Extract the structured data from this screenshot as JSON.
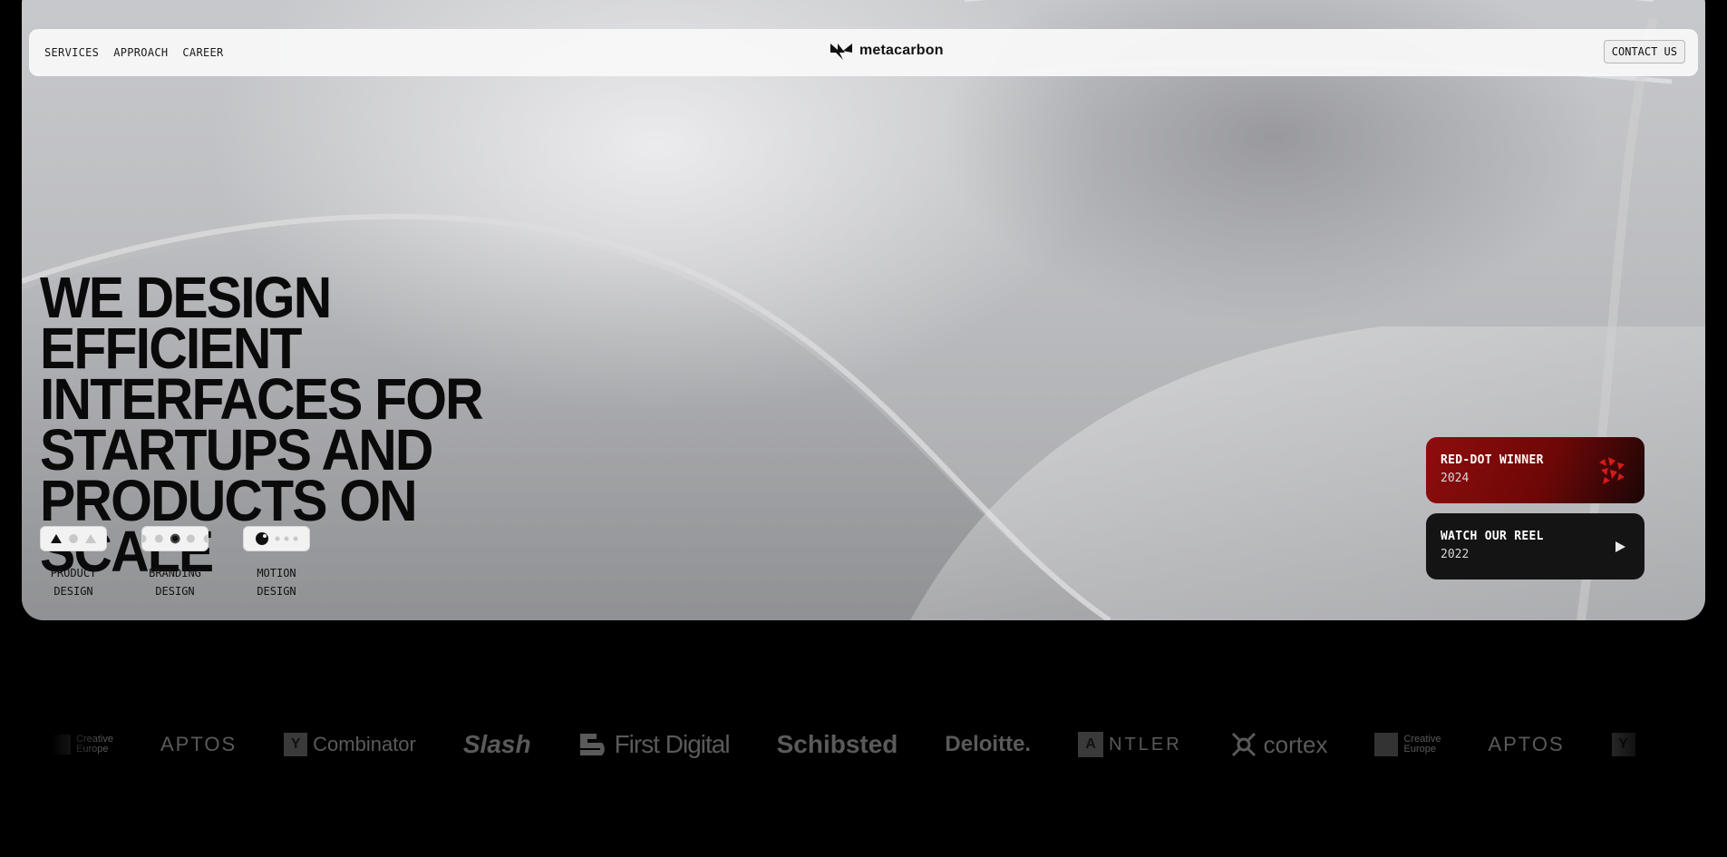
{
  "nav": {
    "links": [
      "SERVICES",
      "APPROACH",
      "CAREER"
    ],
    "brand": "metacarbon",
    "contact_label": "CONTACT US"
  },
  "hero": {
    "headline_lines": [
      "WE DESIGN EFFICIENT",
      "INTERFACES FOR",
      "STARTUPS AND",
      "PRODUCTS ON SCALE"
    ],
    "services": [
      {
        "line1": "PRODUCT",
        "line2": "DESIGN"
      },
      {
        "line1": "BRANDING",
        "line2": "DESIGN"
      },
      {
        "line1": "MOTION",
        "line2": "DESIGN"
      }
    ]
  },
  "cards": {
    "award": {
      "title": "RED-DOT WINNER",
      "year": "2024"
    },
    "reel": {
      "title": "WATCH OUR REEL",
      "year": "2022"
    }
  },
  "logos": [
    {
      "type": "stack",
      "line1": "Creative",
      "line2": "Europe"
    },
    {
      "type": "text",
      "name": "APTOS"
    },
    {
      "type": "box",
      "box": "Y",
      "name": "Combinator"
    },
    {
      "type": "text",
      "name": "Slash"
    },
    {
      "type": "icon",
      "name": "First Digital"
    },
    {
      "type": "text",
      "name": "Schibsted"
    },
    {
      "type": "text",
      "name": "Deloitte."
    },
    {
      "type": "box",
      "box": "A",
      "name": "NTLER"
    },
    {
      "type": "icon",
      "name": "cortex"
    },
    {
      "type": "stack",
      "line1": "Creative",
      "line2": "Europe"
    },
    {
      "type": "text",
      "name": "APTOS"
    },
    {
      "type": "box",
      "box": "Y",
      "name": ""
    }
  ],
  "colors": {
    "award_red": "#8e0d0d",
    "card_dark": "#141414",
    "logo_gray": "#5a5a5a"
  }
}
